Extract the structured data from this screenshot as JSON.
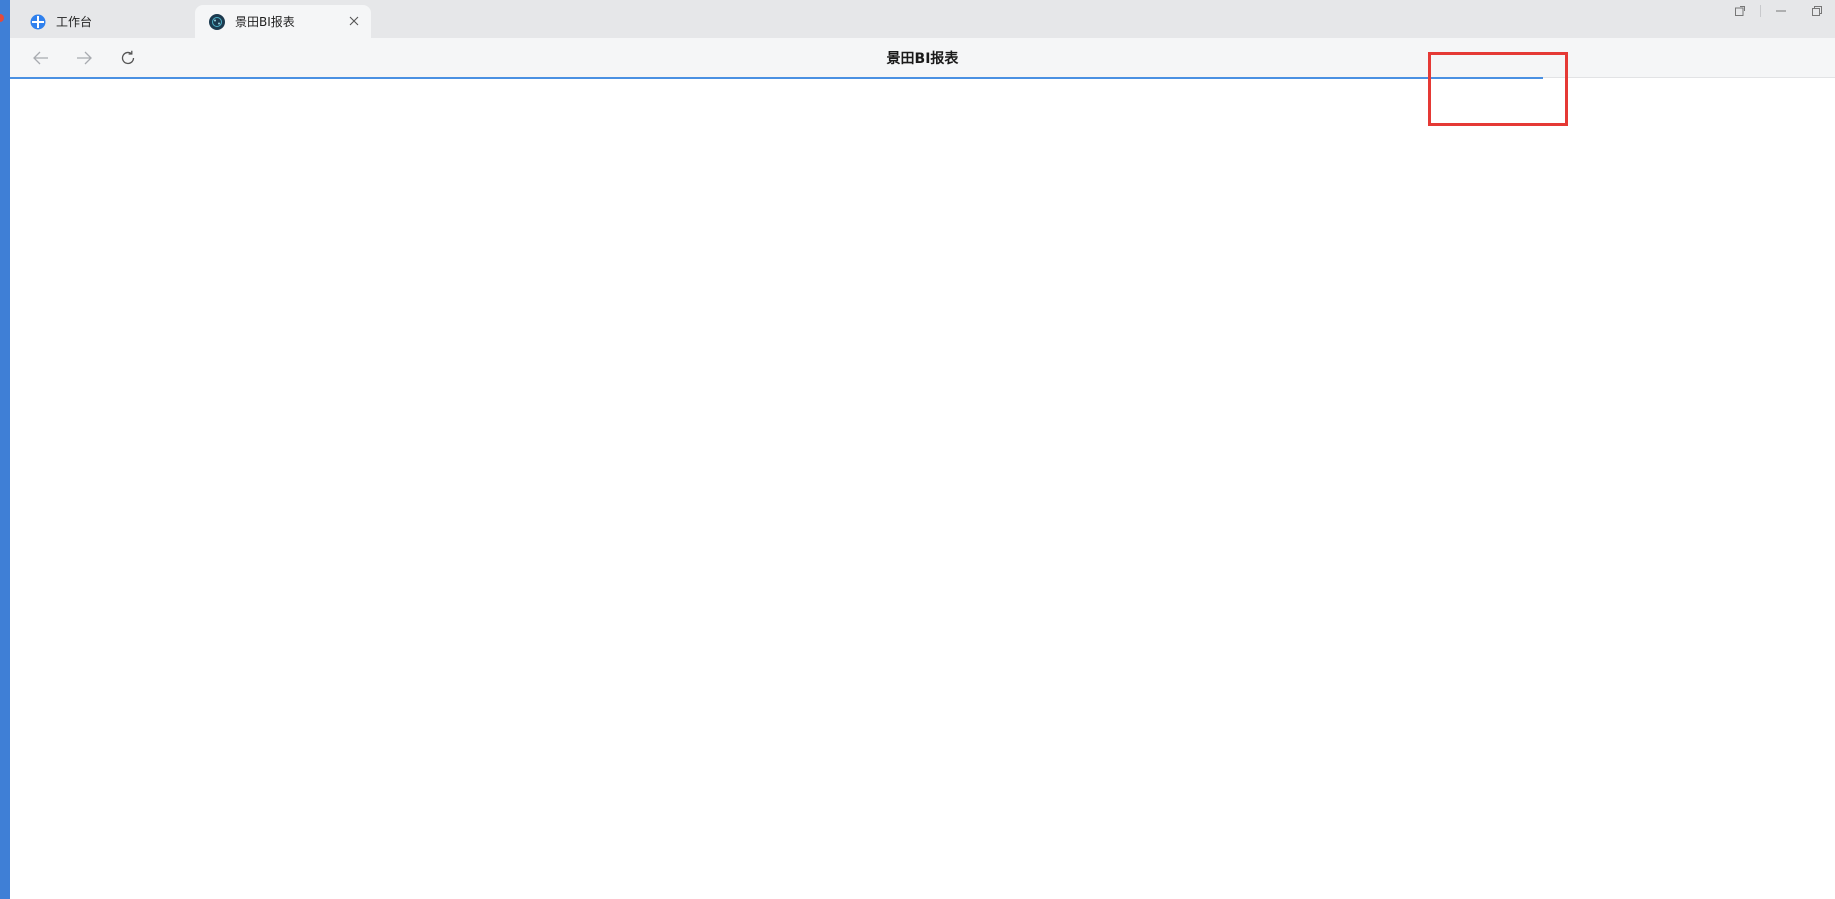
{
  "tabs": [
    {
      "label": "工作台",
      "icon": "workbench-icon",
      "active": false
    },
    {
      "label": "景田BI报表",
      "icon": "bi-report-icon",
      "active": true
    }
  ],
  "page": {
    "title": "景田BI报表"
  },
  "loading": {
    "progress_fraction": 0.84
  },
  "colors": {
    "accent": "#4a90e2",
    "highlight": "#e53935",
    "left_strip": "#3f7fd6"
  }
}
